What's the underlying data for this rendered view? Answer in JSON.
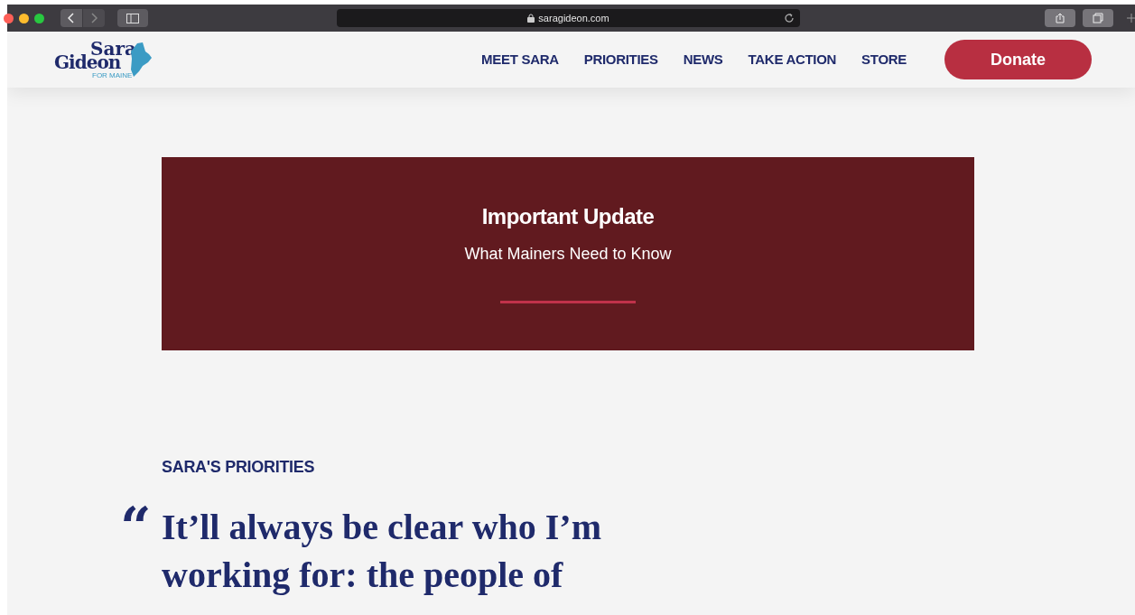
{
  "browser": {
    "url": "saragideon.com"
  },
  "logo": {
    "line_1": "Sara",
    "line_2": "Gideon",
    "tagline": "FOR MAINE"
  },
  "nav": {
    "items": [
      {
        "label": "MEET SARA"
      },
      {
        "label": "PRIORITIES"
      },
      {
        "label": "NEWS"
      },
      {
        "label": "TAKE ACTION"
      },
      {
        "label": "STORE"
      }
    ],
    "donate": "Donate"
  },
  "banner": {
    "title": "Important Update",
    "subtitle": "What Mainers Need to Know"
  },
  "priorities": {
    "heading": "SARA'S PRIORITIES",
    "quote_mark": "“",
    "quote": "It’ll always be clear who I’m working for: the people of"
  }
}
